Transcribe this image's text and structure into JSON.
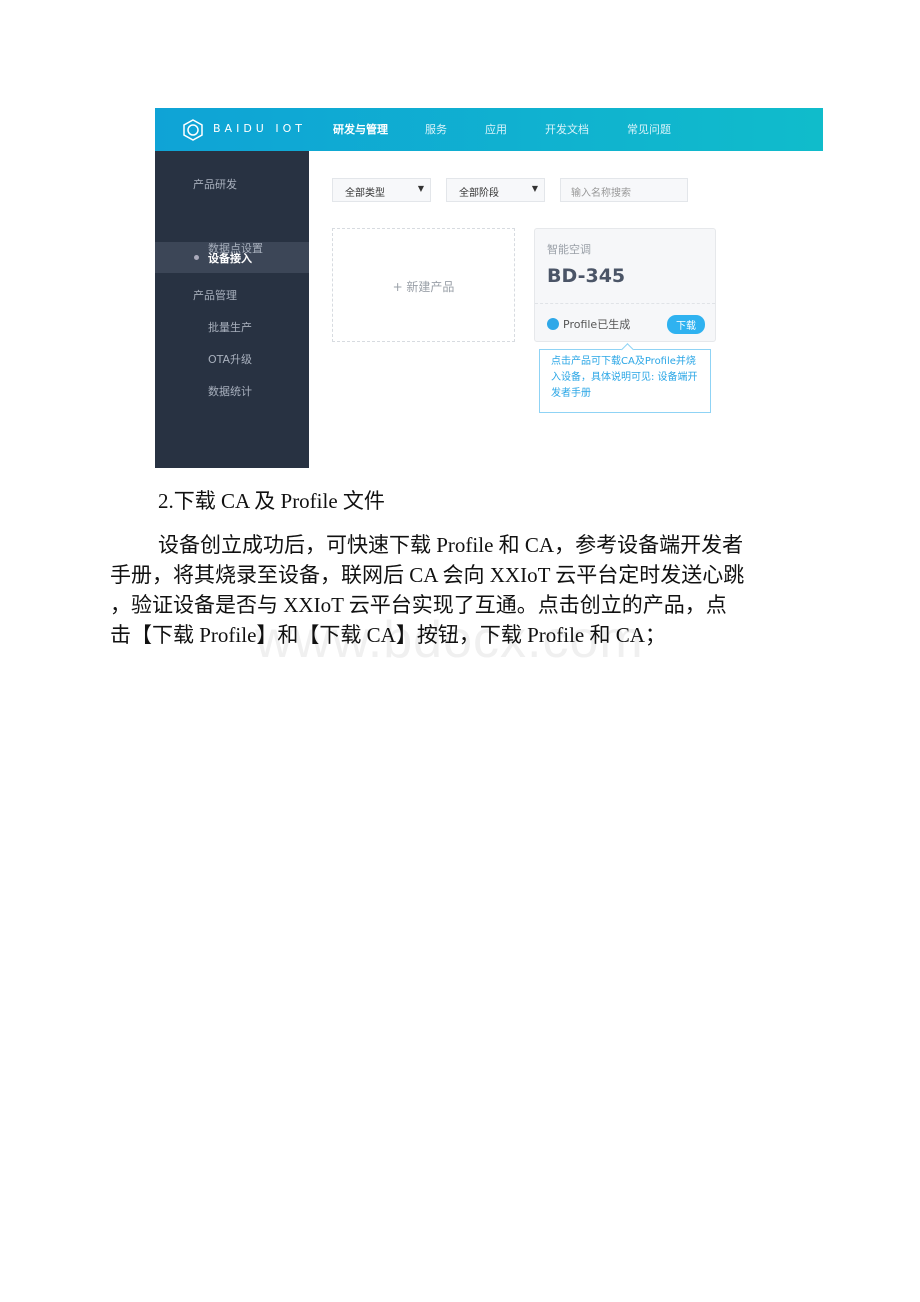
{
  "screenshot": {
    "brand": "BAIDU IOT",
    "nav": [
      "研发与管理",
      "服务",
      "应用",
      "开发文档",
      "常见问题"
    ],
    "sidebar": {
      "groups": [
        {
          "label": "产品研发",
          "items": [
            "设备接入",
            "数据点设置"
          ]
        },
        {
          "label": "产品管理",
          "items": [
            "批量生产",
            "OTA升级",
            "数据统计"
          ]
        }
      ],
      "active": "设备接入"
    },
    "filters": {
      "type": "全部类型",
      "stage": "全部阶段",
      "search_placeholder": "输入名称搜索"
    },
    "new_product": "+ 新建产品",
    "card": {
      "category": "智能空调",
      "name": "BD-345",
      "status": "Profile已生成",
      "download": "下载"
    },
    "tooltip": "点击产品可下载CA及Profile并烧入设备，具体说明可见: 设备端开发者手册",
    "colors": {
      "header_start": "#0fa3d6",
      "header_end": "#10bccb",
      "sidebar": "#283242",
      "accent": "#2fb2f0"
    }
  },
  "heading": "2.下载 CA 及 Profile 文件",
  "paragraph": [
    "设备创立成功后，可快速下载 Profile 和 CA，参考设备端开发者",
    "手册，将其烧录至设备，联网后 CA 会向 XXIoT 云平台定时发送心跳",
    "，验证设备是否与 XXIoT 云平台实现了互通。点击创立的产品，点",
    "击【下载 Profile】和【下载 CA】按钮，下载 Profile 和 CA；"
  ],
  "watermark": "www.bdocx.com"
}
